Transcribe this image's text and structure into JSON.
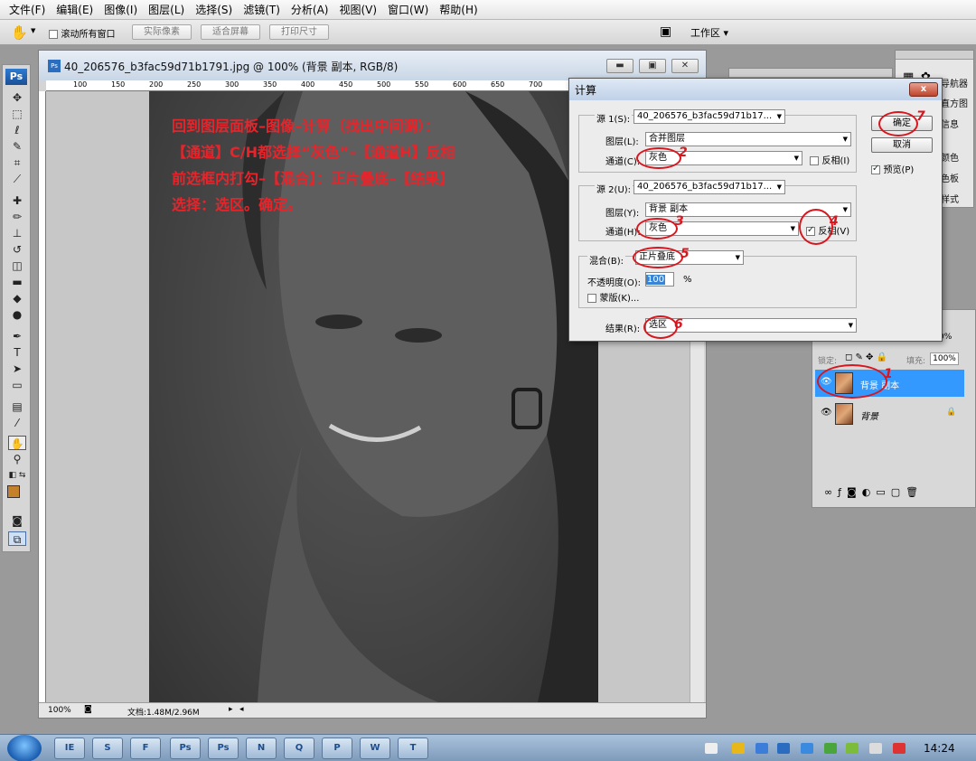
{
  "menu": [
    "文件(F)",
    "编辑(E)",
    "图像(I)",
    "图层(L)",
    "选择(S)",
    "滤镜(T)",
    "分析(A)",
    "视图(V)",
    "窗口(W)",
    "帮助(H)"
  ],
  "options_bar": {
    "scroll_all_label": "滚动所有窗口",
    "actual_pixels": "实际像素",
    "fit_screen": "适合屏幕",
    "print_size": "打印尺寸",
    "workspace": "工作区"
  },
  "tools": {
    "ps_logo": "Ps"
  },
  "document": {
    "title": "40_206576_b3fac59d71b1791.jpg @ 100% (背景 副本, RGB/8)",
    "ps_icon": "Ps",
    "zoom": "100%",
    "doc_size": "文档:1.48M/2.96M",
    "ruler_labels": [
      "100",
      "150",
      "200",
      "250",
      "300",
      "350",
      "400",
      "450",
      "500",
      "550",
      "600",
      "650",
      "700",
      "750",
      "800",
      "850"
    ],
    "vruler_labels": [
      "1",
      "5",
      "0",
      "1",
      "5",
      "0",
      "2",
      "0",
      "0",
      "2",
      "5",
      "0",
      "3",
      "0",
      "0",
      "3",
      "5",
      "0",
      "4",
      "0",
      "0",
      "4",
      "5",
      "0",
      "5",
      "0",
      "0",
      "5",
      "5",
      "0",
      "6",
      "0",
      "0",
      "6",
      "5",
      "0",
      "7",
      "0",
      "0"
    ]
  },
  "instruction_lines": [
    "回到图层面板–图像–计算（找出中间调）：",
    "【通道】C/H都选择“灰色”–【通道H】反相",
    "前选框内打勾–【混合】：正片叠底–【结果】",
    "选择：选区。确定。"
  ],
  "calc_dialog": {
    "title": "计算",
    "close": "x",
    "source1_label": "源 1(S):",
    "source1_file": "40_206576_b3fac59d71b17...",
    "layer1_label": "图层(L):",
    "layer1_value": "合并图层",
    "channel1_label": "通道(C):",
    "channel1_value": "灰色",
    "invert1_label": "反相(I)",
    "source2_label": "源 2(U):",
    "source2_file": "40_206576_b3fac59d71b17...",
    "layer2_label": "图层(Y):",
    "layer2_value": "背景 副本",
    "channel2_label": "通道(H):",
    "channel2_value": "灰色",
    "invert2_label": "反相(V)",
    "blend_label": "混合(B):",
    "blend_value": "正片叠底",
    "opacity_label": "不透明度(O):",
    "opacity_value": "100",
    "opacity_unit": "%",
    "mask_label": "蒙版(K)...",
    "result_label": "结果(R):",
    "result_value": "选区",
    "ok": "确定",
    "cancel": "取消",
    "preview": "预览(P)",
    "marks": [
      "1",
      "2",
      "3",
      "4",
      "5",
      "6",
      "7"
    ]
  },
  "side_panel": {
    "items": [
      "导航器",
      "直方图",
      "信息",
      "颜色",
      "色板",
      "样式"
    ]
  },
  "layers_panel": {
    "lock_label": "锁定:",
    "fill_label": "填充:",
    "fill_value": "100%",
    "opacity_value": "0%",
    "layers": [
      {
        "name": "背景 副本",
        "selected": true
      },
      {
        "name": "背景",
        "selected": false
      }
    ]
  },
  "taskbar": {
    "items": [
      "IE",
      "S",
      "F",
      "Ps",
      "Ps",
      "N",
      "Q",
      "P",
      "W",
      "T"
    ],
    "clock": "14:24"
  }
}
